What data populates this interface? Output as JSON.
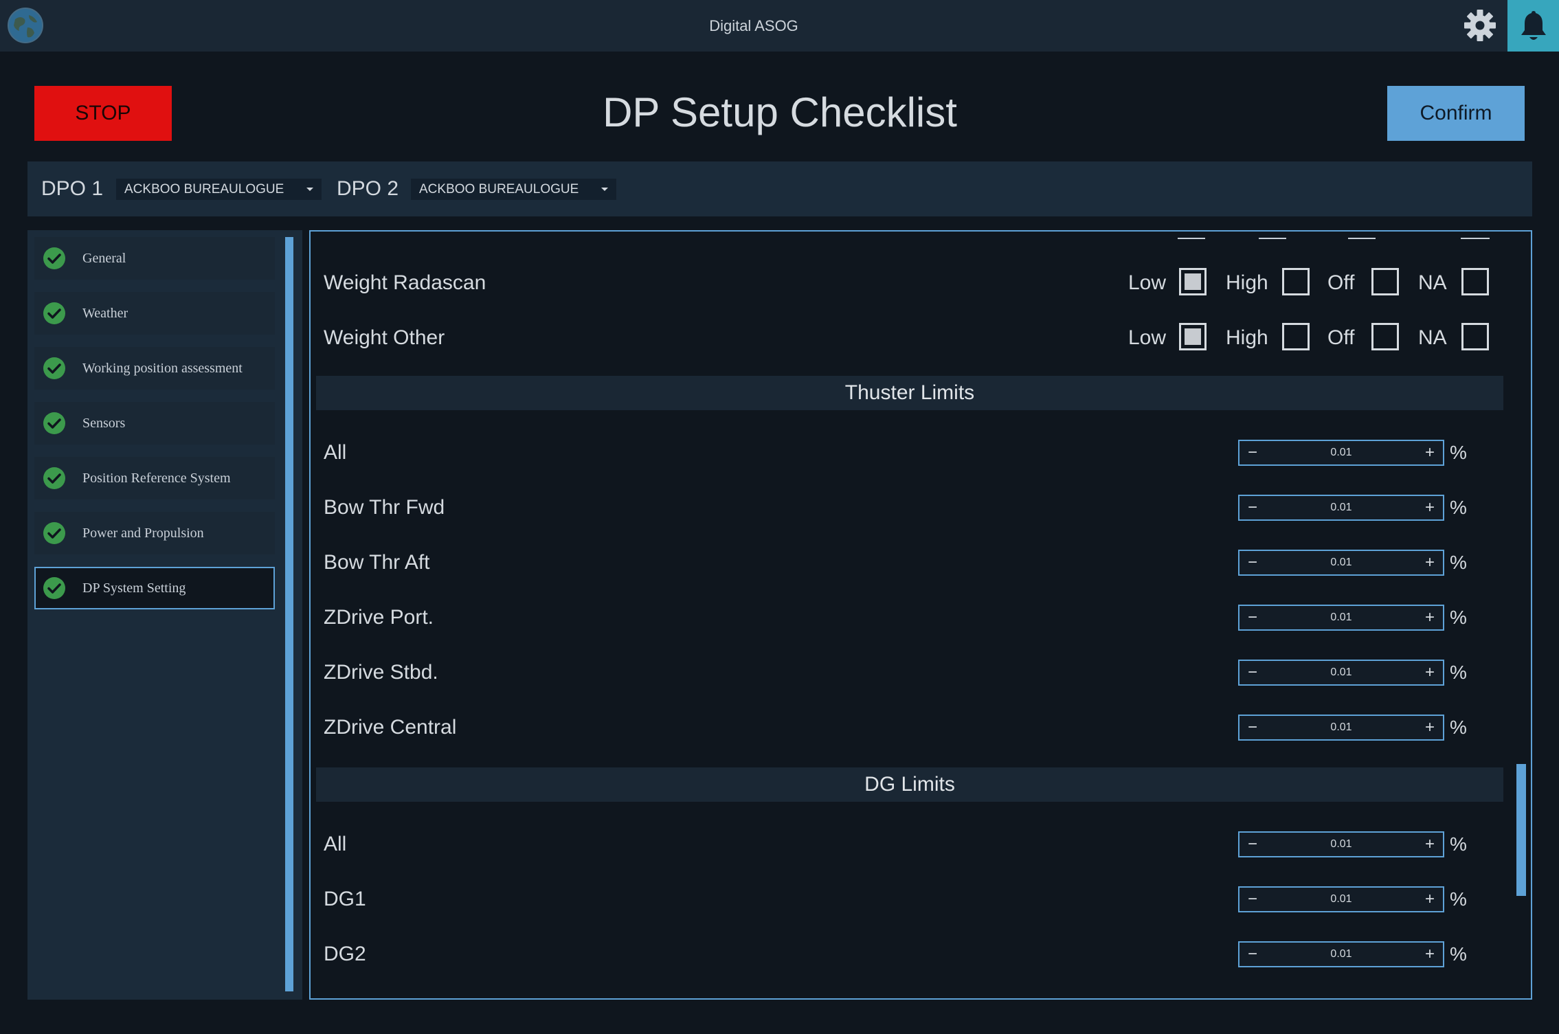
{
  "app": {
    "title": "Digital ASOG",
    "icons": {
      "logo": "globe-icon",
      "settings": "gear-icon",
      "notifications": "bell-icon"
    },
    "colors": {
      "stop": "#e01010",
      "confirm": "#5ea2d7",
      "accent": "#5ea2d7",
      "bell_bg": "#37a6bd",
      "check": "#3c9a4c"
    }
  },
  "header": {
    "stop_label": "STOP",
    "page_title": "DP Setup Checklist",
    "confirm_label": "Confirm"
  },
  "dpo": {
    "dpo1_label": "DPO 1",
    "dpo1_value": "ACKBOO BUREAULOGUE",
    "dpo2_label": "DPO 2",
    "dpo2_value": "ACKBOO BUREAULOGUE"
  },
  "sidebar": {
    "items": [
      {
        "label": "General",
        "done": true
      },
      {
        "label": "Weather",
        "done": true
      },
      {
        "label": "Working position assessment",
        "done": true
      },
      {
        "label": "Sensors",
        "done": true
      },
      {
        "label": "Position Reference System",
        "done": true
      },
      {
        "label": "Power and Propulsion",
        "done": true
      },
      {
        "label": "DP System Setting",
        "done": true,
        "active": true
      }
    ]
  },
  "main": {
    "weight_rows": [
      {
        "label": "Weight Radascan",
        "selected": "Low"
      },
      {
        "label": "Weight Other",
        "selected": "Low"
      }
    ],
    "options": [
      "Low",
      "High",
      "Off",
      "NA"
    ],
    "thruster_section": {
      "title": "Thuster Limits",
      "rows": [
        {
          "label": "All",
          "value": "0.01",
          "unit": "%"
        },
        {
          "label": "Bow Thr Fwd",
          "value": "0.01",
          "unit": "%"
        },
        {
          "label": "Bow Thr Aft",
          "value": "0.01",
          "unit": "%"
        },
        {
          "label": "ZDrive Port.",
          "value": "0.01",
          "unit": "%"
        },
        {
          "label": "ZDrive Stbd.",
          "value": "0.01",
          "unit": "%"
        },
        {
          "label": "ZDrive Central",
          "value": "0.01",
          "unit": "%"
        }
      ]
    },
    "dg_section": {
      "title": "DG Limits",
      "rows": [
        {
          "label": "All",
          "value": "0.01",
          "unit": "%"
        },
        {
          "label": "DG1",
          "value": "0.01",
          "unit": "%"
        },
        {
          "label": "DG2",
          "value": "0.01",
          "unit": "%"
        }
      ]
    },
    "stepper_minus": "−",
    "stepper_plus": "+"
  }
}
